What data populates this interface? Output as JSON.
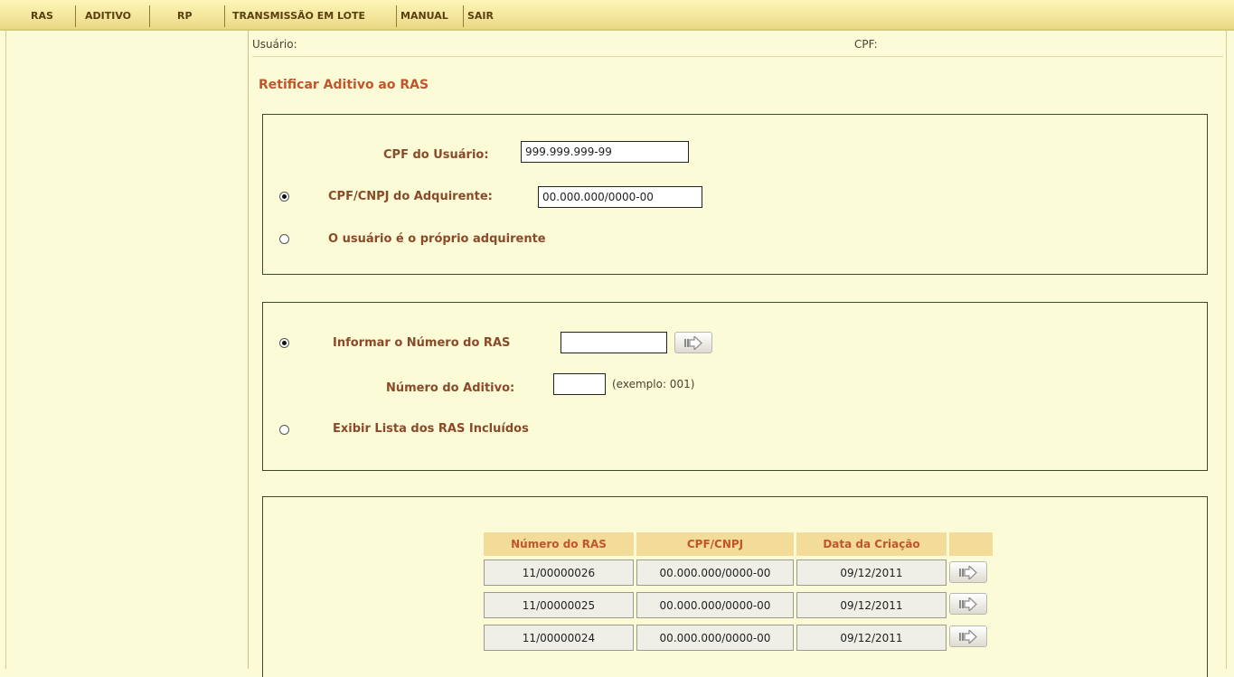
{
  "menu": {
    "items": [
      {
        "label": "RAS"
      },
      {
        "label": "ADITIVO"
      },
      {
        "label": "RP"
      },
      {
        "label": "TRANSMISSÃO EM LOTE"
      },
      {
        "label": "MANUAL"
      },
      {
        "label": "SAIR"
      }
    ]
  },
  "header": {
    "user_label": "Usuário:",
    "cpf_label": "CPF:"
  },
  "page_title": "Retificar Aditivo ao RAS",
  "panel1": {
    "cpf_usuario_label": "CPF do Usuário:",
    "cpf_usuario_value": "999.999.999-99",
    "cpf_cnpj_label": "CPF/CNPJ do Adquirente:",
    "cpf_cnpj_value": "00.000.000/0000-00",
    "proprio_label": "O usuário é o próprio adquirente",
    "selected": "cpf_cnpj"
  },
  "panel2": {
    "informar_label": "Informar o Número do RAS",
    "informar_value": "",
    "aditivo_label": "Número do Aditivo:",
    "aditivo_value": "",
    "aditivo_hint": "(exemplo: 001)",
    "exibir_label": "Exibir Lista dos RAS Incluídos",
    "selected": "informar",
    "go_icon": "arrow-right-icon"
  },
  "table": {
    "headers": [
      "Número do RAS",
      "CPF/CNPJ",
      "Data da Criação",
      ""
    ],
    "rows": [
      {
        "numero": "11/00000026",
        "cpf_cnpj": "00.000.000/0000-00",
        "data": "09/12/2011"
      },
      {
        "numero": "11/00000025",
        "cpf_cnpj": "00.000.000/0000-00",
        "data": "09/12/2011"
      },
      {
        "numero": "11/00000024",
        "cpf_cnpj": "00.000.000/0000-00",
        "data": "09/12/2011"
      }
    ],
    "row_action_icon": "arrow-right-icon"
  },
  "colors": {
    "background": "#fcfbd8",
    "menu_bar": "#f3e59a",
    "title": "#c0562a",
    "label": "#8a4a2a",
    "table_header_bg": "#f3dc9a",
    "panel_border": "#3e4a22"
  }
}
